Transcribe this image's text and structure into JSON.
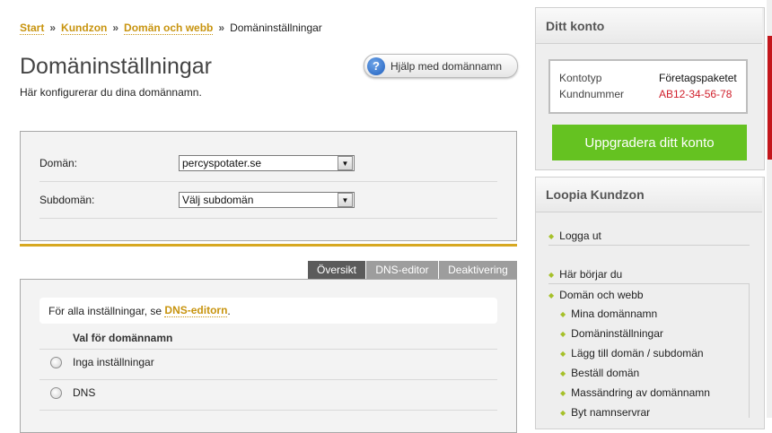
{
  "breadcrumb": {
    "items": [
      "Start",
      "Kundzon",
      "Domän och webb"
    ],
    "separator": "»",
    "current": "Domäninställningar"
  },
  "page": {
    "title": "Domäninställningar",
    "subtitle": "Här konfigurerar du dina domännamn.",
    "help_button": "Hjälp med domännamn",
    "help_icon": "?"
  },
  "form": {
    "domain_label": "Domän:",
    "domain_value": "percyspotater.se",
    "subdomain_label": "Subdomän:",
    "subdomain_value": "Välj subdomän"
  },
  "tabs": [
    "Översikt",
    "DNS-editor",
    "Deaktivering"
  ],
  "overview": {
    "note_prefix": "För alla inställningar, se",
    "note_link": "DNS-editorn",
    "note_suffix": ".",
    "options_header": "Val för domännamn",
    "options": [
      "Inga inställningar",
      "DNS"
    ]
  },
  "sidebar": {
    "account": {
      "title": "Ditt konto",
      "rows": [
        {
          "label": "Kontotyp",
          "value": "Företagspaketet"
        },
        {
          "label": "Kundnummer",
          "value": "AB12-34-56-78"
        }
      ],
      "upgrade_button": "Uppgradera ditt konto"
    },
    "kundzon": {
      "title": "Loopia Kundzon",
      "logout": "Logga ut",
      "start": "Här börjar du",
      "section": "Domän och webb",
      "subitems": [
        "Mina domännamn",
        "Domäninställningar",
        "Lägg till domän / subdomän",
        "Beställ domän",
        "Massändring av domännamn",
        "Byt namnservrar"
      ]
    }
  },
  "colors": {
    "link_gold": "#c8940f",
    "accent_line": "#d7a821",
    "upgrade_green": "#65c221",
    "customer_number_red": "#d0202c",
    "bullet_green": "#a6c02a"
  }
}
